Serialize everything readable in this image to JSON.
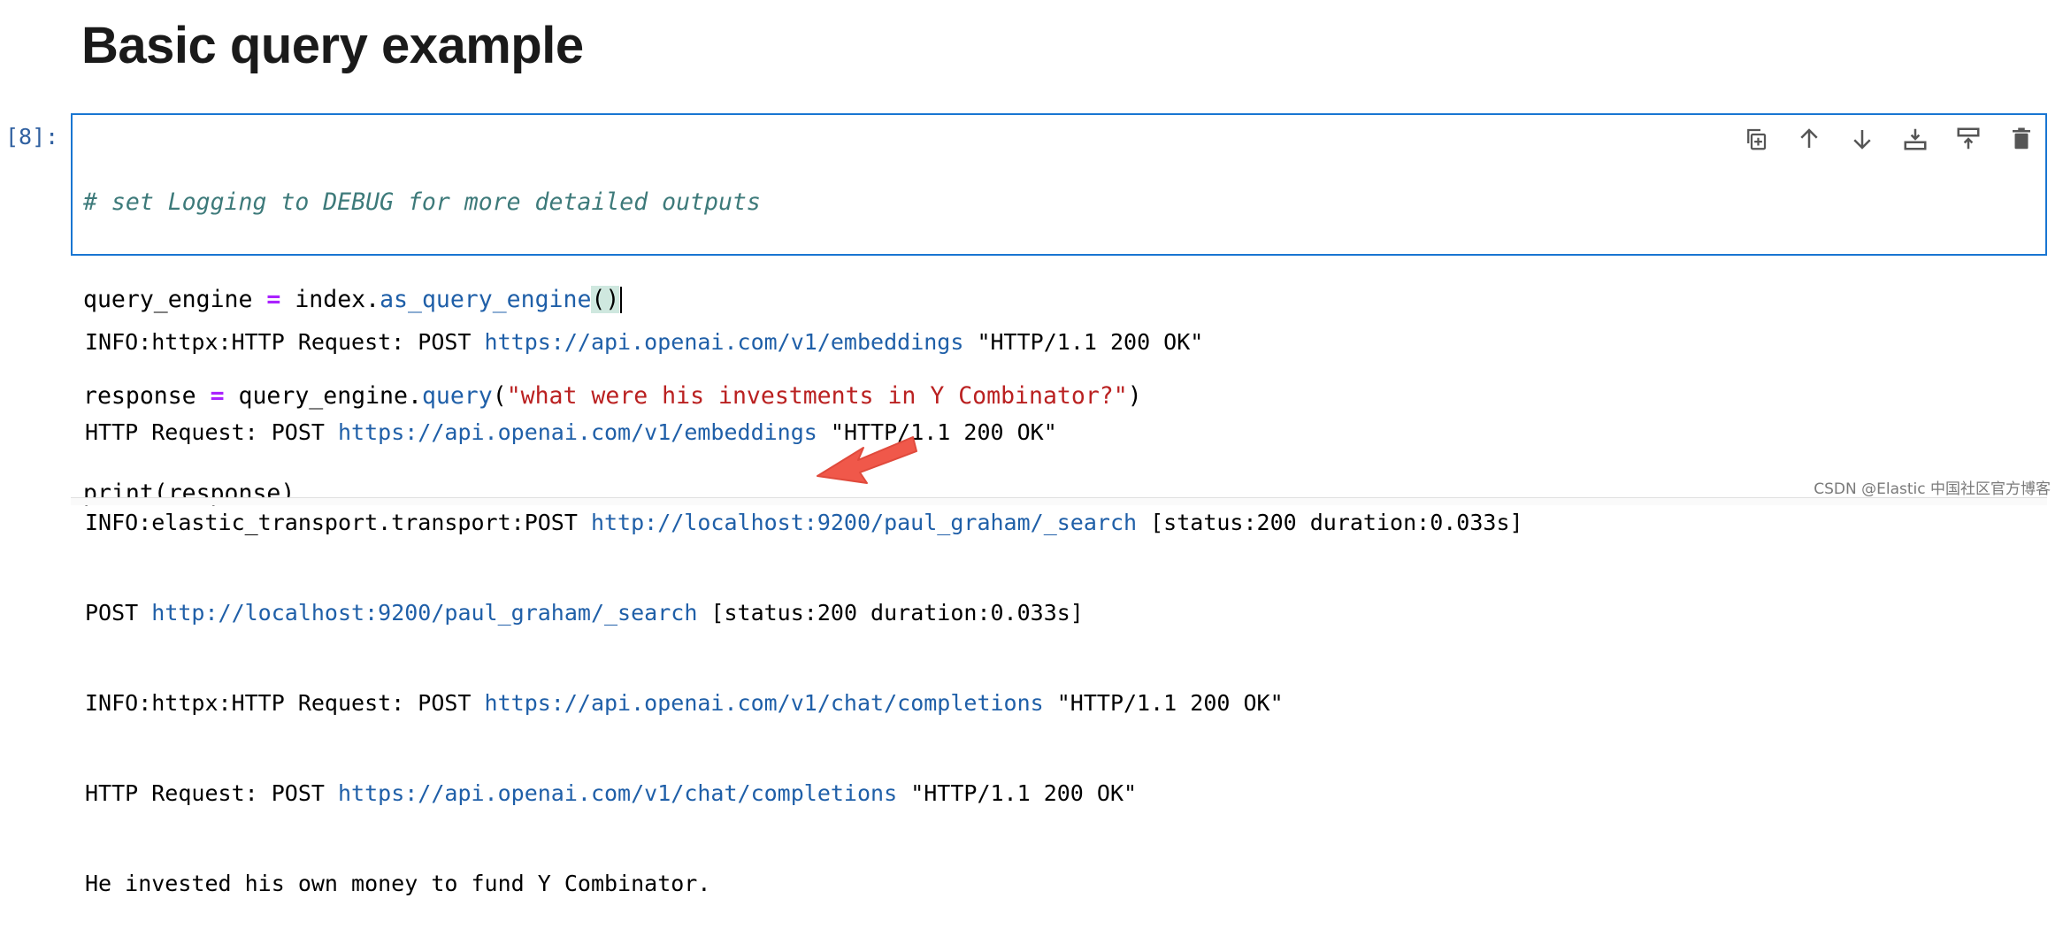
{
  "heading": "Basic query example",
  "cell": {
    "prompt": "[8]:",
    "code": {
      "line1_comment": "# set Logging to DEBUG for more detailed outputs",
      "line2": {
        "var": "query_engine ",
        "op": "=",
        "obj": " index.",
        "fn": "as_query_engine",
        "paren": "()"
      },
      "line3": {
        "var": "response ",
        "op": "=",
        "obj": " query_engine.",
        "fn": "query",
        "open": "(",
        "str": "\"what were his investments in Y Combinator?\"",
        "close": ")"
      },
      "line4": "print(response)"
    },
    "toolbar_icons": [
      "copy-icon",
      "arrow-up-icon",
      "arrow-down-icon",
      "insert-above-icon",
      "insert-below-icon",
      "trash-icon"
    ]
  },
  "output": {
    "l1": {
      "pre": "INFO:httpx:HTTP Request: POST ",
      "url": "https://api.openai.com/v1/embeddings",
      "post": " \"HTTP/1.1 200 OK\""
    },
    "l2": {
      "pre": "HTTP Request: POST ",
      "url": "https://api.openai.com/v1/embeddings",
      "post": " \"HTTP/1.1 200 OK\""
    },
    "l3": {
      "pre": "INFO:elastic_transport.transport:POST ",
      "url": "http://localhost:9200/paul_graham/_search",
      "post": " [status:200 duration:0.033s]"
    },
    "l4": {
      "pre": "POST ",
      "url": "http://localhost:9200/paul_graham/_search",
      "post": " [status:200 duration:0.033s]"
    },
    "l5": {
      "pre": "INFO:httpx:HTTP Request: POST ",
      "url": "https://api.openai.com/v1/chat/completions",
      "post": " \"HTTP/1.1 200 OK\""
    },
    "l6": {
      "pre": "HTTP Request: POST ",
      "url": "https://api.openai.com/v1/chat/completions",
      "post": " \"HTTP/1.1 200 OK\""
    },
    "l7": "He invested his own money to fund Y Combinator."
  },
  "watermark": "CSDN @Elastic 中国社区官方博客",
  "colors": {
    "accent": "#1976d2",
    "arrow": "#f0584a"
  }
}
